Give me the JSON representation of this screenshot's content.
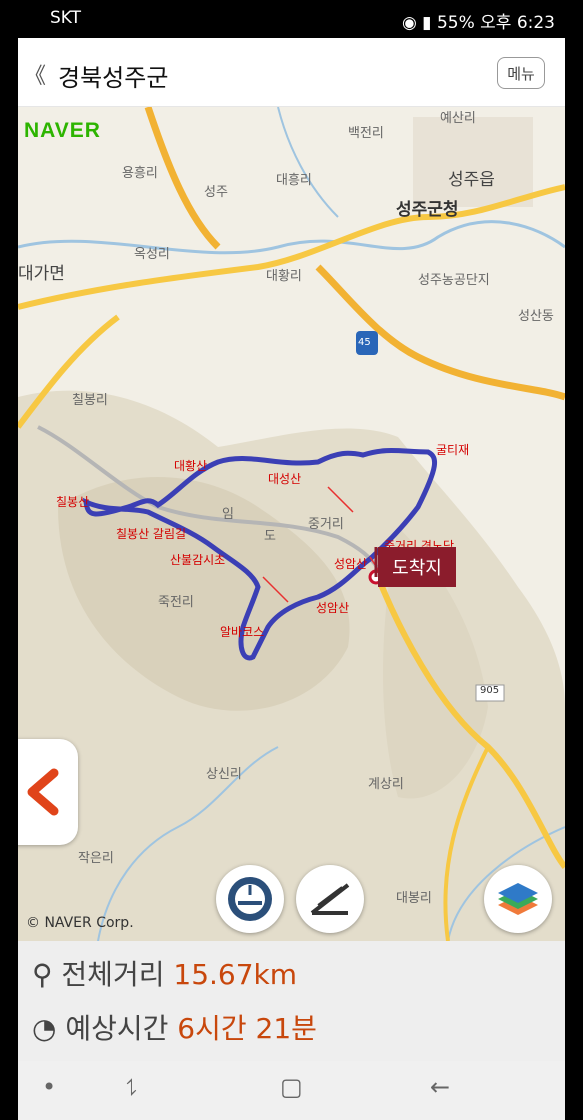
{
  "status": {
    "carrier": "SKT",
    "battery": "55%",
    "time": "오후 6:23"
  },
  "header": {
    "title": "경북성주군",
    "menu_label": "메뉴"
  },
  "map": {
    "brand": "NAVER",
    "copyright": "© NAVER Corp.",
    "place_labels": [
      "백전리",
      "예산리",
      "용흥리",
      "성주",
      "대흥리",
      "성주읍",
      "성주군청",
      "옥성리",
      "대가면",
      "대황리",
      "성주농공단지",
      "45",
      "성산동",
      "칠봉리",
      "대흥리",
      "중거리",
      "상신리",
      "계상리",
      "작은리",
      "대봉리",
      "905",
      "죽전리",
      "임",
      "도"
    ],
    "route_labels": [
      "대황산",
      "대성산",
      "굴티재",
      "칠봉산",
      "칠봉산 갈림길",
      "산불감시초",
      "성암산",
      "성암산",
      "알바코스",
      "중거리 경노당"
    ],
    "destination_label": "도착지"
  },
  "info": {
    "distance_label": "전체거리",
    "distance_value": "15.67km",
    "time_label": "예상시간",
    "time_value": "6시간 21분"
  }
}
